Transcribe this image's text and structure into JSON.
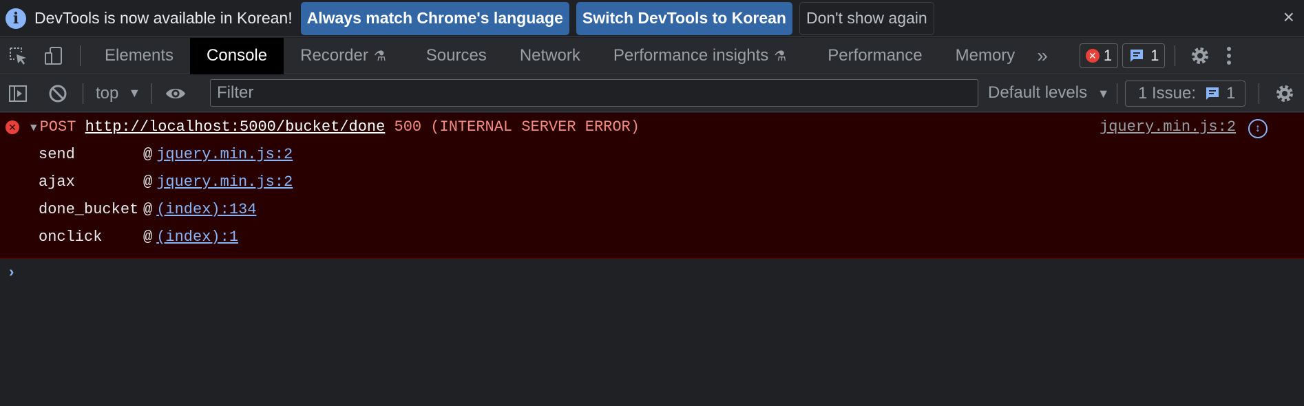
{
  "infobar": {
    "message": "DevTools is now available in Korean!",
    "btn_match": "Always match Chrome's language",
    "btn_switch": "Switch DevTools to Korean",
    "btn_dismiss": "Don't show again",
    "close": "×"
  },
  "tabs": [
    {
      "label": "Elements"
    },
    {
      "label": "Console"
    },
    {
      "label": "Recorder"
    },
    {
      "label": "Sources"
    },
    {
      "label": "Network"
    },
    {
      "label": "Performance insights"
    },
    {
      "label": "Performance"
    },
    {
      "label": "Memory"
    }
  ],
  "active_tab": "Console",
  "tabbar": {
    "more": "»",
    "errors_count": "1",
    "messages_count": "1"
  },
  "filterbar": {
    "context": "top",
    "filter_placeholder": "Filter",
    "levels": "Default levels",
    "issues_label": "1 Issue:",
    "issues_count": "1"
  },
  "console": {
    "error": {
      "method": "POST",
      "url": "http://localhost:5000/bucket/done",
      "status": "500 (INTERNAL SERVER ERROR)",
      "source": "jquery.min.js:2"
    },
    "stack": [
      {
        "fn": "send",
        "at": "@",
        "link": "jquery.min.js:2"
      },
      {
        "fn": "ajax",
        "at": "@",
        "link": "jquery.min.js:2"
      },
      {
        "fn": "done_bucket",
        "at": "@",
        "link": "(index):134"
      },
      {
        "fn": "onclick",
        "at": "@",
        "link": "(index):1"
      }
    ],
    "prompt": "›"
  },
  "colors": {
    "background": "#202124",
    "toolbar": "#292a2d",
    "error_bg": "#290000",
    "error_text": "#f28b82",
    "link": "#8ab4f8",
    "button_primary": "#3266a4"
  }
}
